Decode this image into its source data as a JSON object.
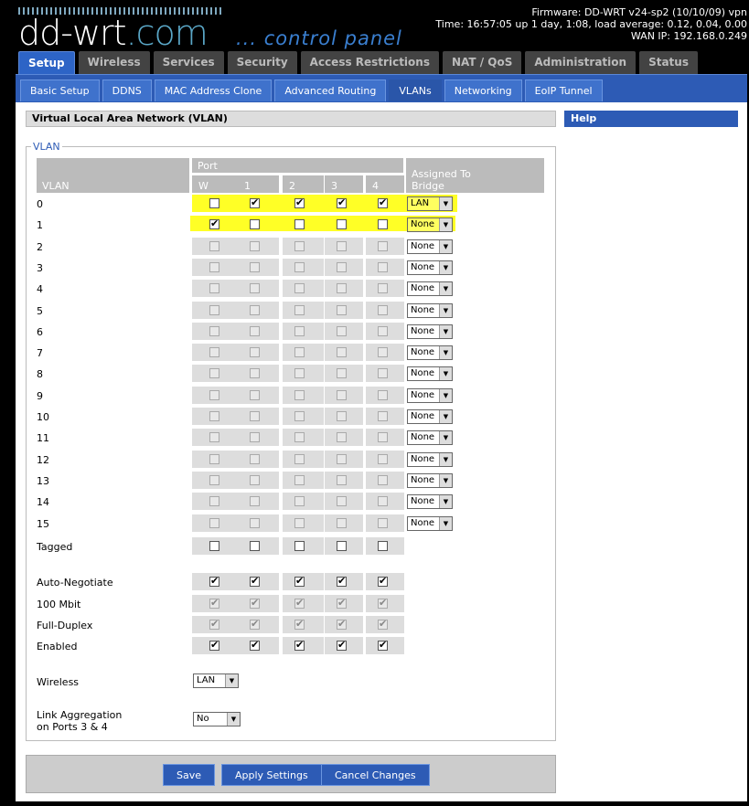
{
  "header": {
    "logo_text_main": "dd-wrt",
    "logo_text_com": ".com",
    "logo_subtitle": "... control panel",
    "firmware": "Firmware: DD-WRT v24-sp2 (10/10/09) vpn",
    "time": "Time: 16:57:05 up 1 day, 1:08, load average: 0.12, 0.04, 0.00",
    "wan_ip": "WAN IP: 192.168.0.249"
  },
  "main_tabs": [
    "Setup",
    "Wireless",
    "Services",
    "Security",
    "Access Restrictions",
    "NAT / QoS",
    "Administration",
    "Status"
  ],
  "sub_tabs": [
    "Basic Setup",
    "DDNS",
    "MAC Address Clone",
    "Advanced Routing",
    "VLANs",
    "Networking",
    "EoIP Tunnel"
  ],
  "section": {
    "title": "Virtual Local Area Network (VLAN)",
    "help": "Help",
    "legend": "VLAN"
  },
  "table": {
    "vlan_header": "VLAN",
    "port_header": "Port",
    "assigned_header_1": "Assigned To",
    "assigned_header_2": "Bridge",
    "ports": [
      "W",
      "1",
      "2",
      "3",
      "4"
    ],
    "vlans": [
      {
        "id": "0",
        "checks": [
          false,
          true,
          true,
          true,
          true
        ],
        "bridge": "LAN"
      },
      {
        "id": "1",
        "checks": [
          true,
          false,
          false,
          false,
          false
        ],
        "bridge": "None"
      },
      {
        "id": "2",
        "checks": [
          false,
          false,
          false,
          false,
          false
        ],
        "bridge": "None"
      },
      {
        "id": "3",
        "checks": [
          false,
          false,
          false,
          false,
          false
        ],
        "bridge": "None"
      },
      {
        "id": "4",
        "checks": [
          false,
          false,
          false,
          false,
          false
        ],
        "bridge": "None"
      },
      {
        "id": "5",
        "checks": [
          false,
          false,
          false,
          false,
          false
        ],
        "bridge": "None"
      },
      {
        "id": "6",
        "checks": [
          false,
          false,
          false,
          false,
          false
        ],
        "bridge": "None"
      },
      {
        "id": "7",
        "checks": [
          false,
          false,
          false,
          false,
          false
        ],
        "bridge": "None"
      },
      {
        "id": "8",
        "checks": [
          false,
          false,
          false,
          false,
          false
        ],
        "bridge": "None"
      },
      {
        "id": "9",
        "checks": [
          false,
          false,
          false,
          false,
          false
        ],
        "bridge": "None"
      },
      {
        "id": "10",
        "checks": [
          false,
          false,
          false,
          false,
          false
        ],
        "bridge": "None"
      },
      {
        "id": "11",
        "checks": [
          false,
          false,
          false,
          false,
          false
        ],
        "bridge": "None"
      },
      {
        "id": "12",
        "checks": [
          false,
          false,
          false,
          false,
          false
        ],
        "bridge": "None"
      },
      {
        "id": "13",
        "checks": [
          false,
          false,
          false,
          false,
          false
        ],
        "bridge": "None"
      },
      {
        "id": "14",
        "checks": [
          false,
          false,
          false,
          false,
          false
        ],
        "bridge": "None"
      },
      {
        "id": "15",
        "checks": [
          false,
          false,
          false,
          false,
          false
        ],
        "bridge": "None"
      }
    ],
    "tagged": {
      "label": "Tagged",
      "checks": [
        false,
        false,
        false,
        false,
        false
      ]
    },
    "options": [
      {
        "label": "Auto-Negotiate",
        "checks": [
          true,
          true,
          true,
          true,
          true
        ],
        "disabled": false
      },
      {
        "label": "100 Mbit",
        "checks": [
          true,
          true,
          true,
          true,
          true
        ],
        "disabled": true
      },
      {
        "label": "Full-Duplex",
        "checks": [
          true,
          true,
          true,
          true,
          true
        ],
        "disabled": true
      },
      {
        "label": "Enabled",
        "checks": [
          true,
          true,
          true,
          true,
          true
        ],
        "disabled": false
      }
    ]
  },
  "wireless": {
    "label": "Wireless",
    "value": "LAN"
  },
  "link_aggregation": {
    "label_1": "Link Aggregation",
    "label_2": "on Ports 3 & 4",
    "value": "No"
  },
  "buttons": {
    "save": "Save",
    "apply": "Apply Settings",
    "cancel": "Cancel Changes"
  },
  "colors": {
    "accent": "#2d5bb5",
    "highlight": "#ffff00"
  }
}
